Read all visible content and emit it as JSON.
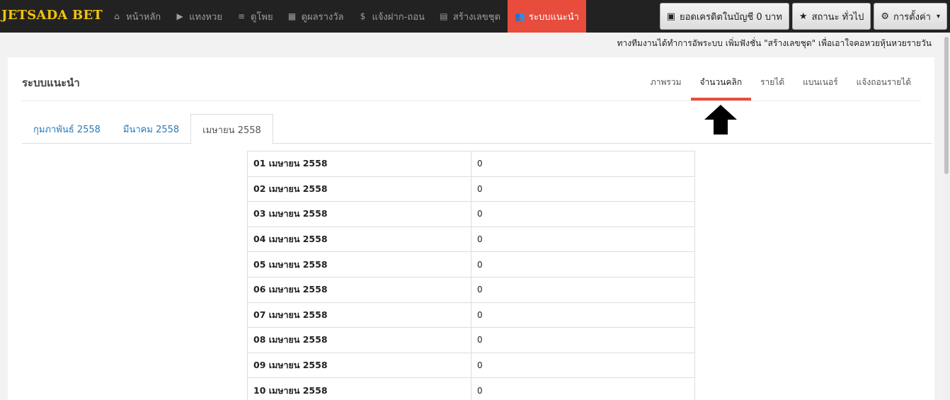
{
  "navbar": {
    "brand": "JETSADA BET",
    "items": [
      {
        "label": "หน้าหลัก",
        "icon": "home-icon",
        "glyph": "⌂"
      },
      {
        "label": "แทงหวย",
        "icon": "play-circle-icon",
        "glyph": "▶"
      },
      {
        "label": "ดูโพย",
        "icon": "list-icon",
        "glyph": "≡"
      },
      {
        "label": "ดูผลรางวัล",
        "icon": "table-icon",
        "glyph": "▦"
      },
      {
        "label": "แจ้งฝาก-ถอน",
        "icon": "dollar-icon",
        "glyph": "$"
      },
      {
        "label": "สร้างเลขชุด",
        "icon": "document-icon",
        "glyph": "▤"
      },
      {
        "label": "ระบบแนะนำ",
        "icon": "users-icon",
        "glyph": "👥",
        "active": true
      }
    ],
    "credit_button": "ยอดเครดิตในบัญชี 0 บาท",
    "status_button": "สถานะ ทั่วไป",
    "settings_button": "การตั้งค่า"
  },
  "notice": "ทางทีมงานได้ทำการอัพระบบ เพิ่มฟังชั่น \"สร้างเลขชุด\" เพื่อเอาใจคอหวยหุ้นหวยรายวัน",
  "card": {
    "title": "ระบบแนะนำ",
    "tabs": [
      "ภาพรวม",
      "จำนวนคลิก",
      "รายได้",
      "แบนเนอร์",
      "แจ้งถอนรายได้"
    ],
    "active_tab": 1,
    "month_tabs": [
      "กุมภาพันธ์ 2558",
      "มีนาคม 2558",
      "เมษายน 2558"
    ],
    "active_month": 2
  },
  "table": {
    "rows": [
      {
        "date": "01 เมษายน 2558",
        "value": "0"
      },
      {
        "date": "02 เมษายน 2558",
        "value": "0"
      },
      {
        "date": "03 เมษายน 2558",
        "value": "0"
      },
      {
        "date": "04 เมษายน 2558",
        "value": "0"
      },
      {
        "date": "05 เมษายน 2558",
        "value": "0"
      },
      {
        "date": "06 เมษายน 2558",
        "value": "0"
      },
      {
        "date": "07 เมษายน 2558",
        "value": "0"
      },
      {
        "date": "08 เมษายน 2558",
        "value": "0"
      },
      {
        "date": "09 เมษายน 2558",
        "value": "0"
      },
      {
        "date": "10 เมษายน 2558",
        "value": "0"
      }
    ]
  },
  "colors": {
    "navbar_bg": "#222222",
    "brand": "#f1c40f",
    "accent": "#e74c3c",
    "link": "#2a7ab8"
  }
}
